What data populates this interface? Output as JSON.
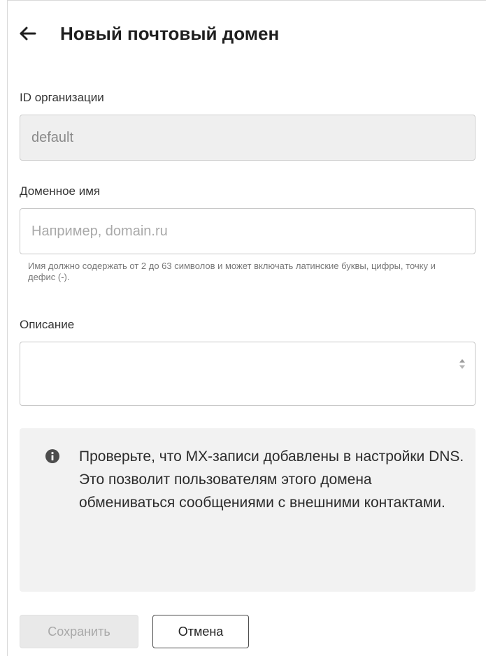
{
  "header": {
    "back_icon": "arrow-left-icon",
    "title": "Новый почтовый домен"
  },
  "form": {
    "org_id": {
      "label": "ID организации",
      "value": "default",
      "disabled": true
    },
    "domain_name": {
      "label": "Доменное имя",
      "value": "",
      "placeholder": "Например, domain.ru",
      "hint": "Имя должно содержать от 2 до 63 символов и может включать латинские буквы, цифры, точку и дефис (-)."
    },
    "description": {
      "label": "Описание",
      "value": ""
    }
  },
  "notice": {
    "icon": "info-circle-icon",
    "text": "Проверьте, что MX-записи добавлены в настройки DNS. Это позволит пользователям этого домена обмениваться сообщениями с внешними контактами."
  },
  "actions": {
    "save_label": "Сохранить",
    "save_disabled": true,
    "cancel_label": "Отмена"
  },
  "colors": {
    "title": "#1f1f1f",
    "notice_background": "#f2f2f2",
    "disabled_field": "#efefef",
    "border": "#c8c8c8"
  }
}
